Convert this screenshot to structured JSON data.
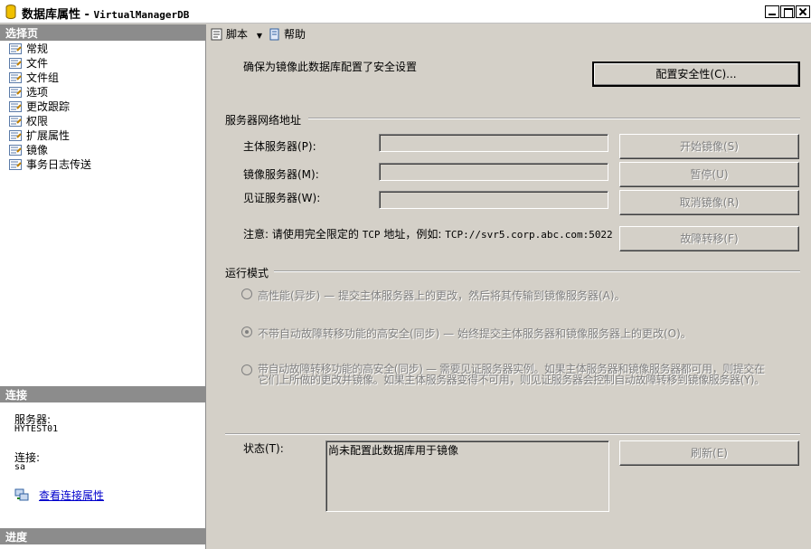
{
  "window": {
    "title_prefix": "数据库属性 - ",
    "title_db": "VirtualManagerDB"
  },
  "left": {
    "select_page_header": "选择页",
    "pages": [
      "常规",
      "文件",
      "文件组",
      "选项",
      "更改跟踪",
      "权限",
      "扩展属性",
      "镜像",
      "事务日志传送"
    ],
    "connection_header": "连接",
    "server_label": "服务器:",
    "server_value": "HYTEST01",
    "connection_label": "连接:",
    "connection_value": "sa",
    "view_connection_link": "查看连接属性",
    "progress_header": "进度"
  },
  "toolbar": {
    "script_label": "脚本",
    "help_label": "帮助"
  },
  "security": {
    "instruction": "确保为镜像此数据库配置了安全设置",
    "configure_button": "配置安全性(C)..."
  },
  "network": {
    "group_label": "服务器网络地址",
    "principal_label": "主体服务器(P):",
    "mirror_label": "镜像服务器(M):",
    "witness_label": "见证服务器(W):",
    "principal_value": "",
    "mirror_value": "",
    "witness_value": "",
    "start_button": "开始镜像(S)",
    "pause_button": "暂停(U)",
    "remove_button": "取消镜像(R)",
    "failover_button": "故障转移(F)",
    "note_prefix": "注意: 请使用完全限定的 ",
    "note_mono": "TCP",
    "note_mid": " 地址，例如: ",
    "note_example": "TCP://svr5.corp.abc.com:5022"
  },
  "operating_mode": {
    "group_label": "运行模式",
    "options": [
      {
        "text": "高性能(异步) — 提交主体服务器上的更改，然后将其传输到镜像服务器(A)。",
        "checked": false
      },
      {
        "text": "不带自动故障转移功能的高安全(同步) — 始终提交主体服务器和镜像服务器上的更改(O)。",
        "checked": true
      },
      {
        "text": "带自动故障转移功能的高安全(同步) — 需要见证服务器实例。如果主体服务器和镜像服务器都可用，则提交在",
        "text2": "它们上所做的更改并镜像。如果主体服务器变得不可用，则见证服务器会控制自动故障转移到镜像服务器(Y)。",
        "checked": false
      }
    ]
  },
  "status": {
    "label": "状态(T):",
    "value": "尚未配置此数据库用于镜像",
    "refresh_button": "刷新(E)"
  }
}
